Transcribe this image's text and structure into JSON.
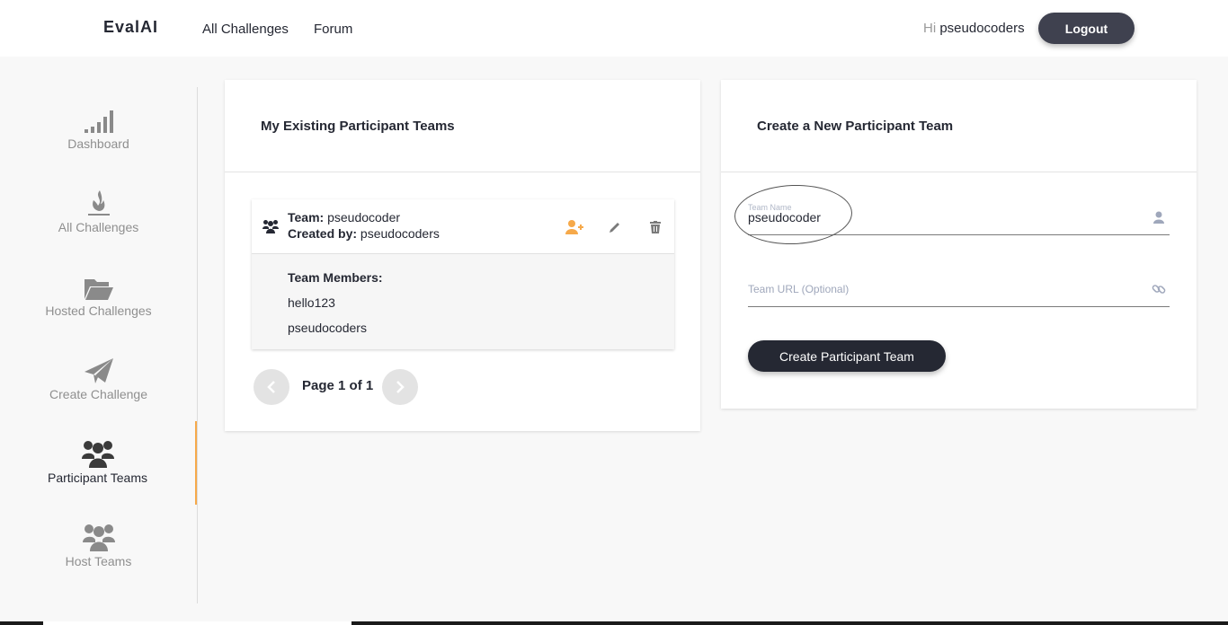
{
  "app": {
    "logo": "EvalAI"
  },
  "nav": {
    "links": [
      "All Challenges",
      "Forum"
    ]
  },
  "user": {
    "greeting": "Hi",
    "username": "pseudocoders",
    "logout_label": "Logout"
  },
  "sidebar": {
    "items": [
      {
        "label": "Dashboard",
        "icon": "signal-bars-icon",
        "active": false
      },
      {
        "label": "All Challenges",
        "icon": "flame-icon",
        "active": false
      },
      {
        "label": "Hosted Challenges",
        "icon": "folder-open-icon",
        "active": false
      },
      {
        "label": "Create Challenge",
        "icon": "paper-plane-icon",
        "active": false
      },
      {
        "label": "Participant Teams",
        "icon": "users-icon",
        "active": true
      },
      {
        "label": "Host Teams",
        "icon": "users-icon",
        "active": false
      }
    ]
  },
  "existing": {
    "title": "My Existing Participant Teams",
    "team": {
      "team_label": "Team:",
      "team_name": "pseudocoder",
      "created_label": "Created by:",
      "created_by": "pseudocoders",
      "members_label": "Team Members:",
      "members": [
        "hello123",
        "pseudocoders"
      ]
    },
    "pager": {
      "text": "Page 1 of 1"
    }
  },
  "create": {
    "title": "Create a New Participant Team",
    "name_label": "Team Name",
    "name_value": "pseudocoder",
    "url_placeholder": "Team URL (Optional)",
    "submit_label": "Create Participant Team"
  },
  "colors": {
    "accent": "#f6a94a",
    "dark": "#252833",
    "muted": "#8f8f8f"
  }
}
